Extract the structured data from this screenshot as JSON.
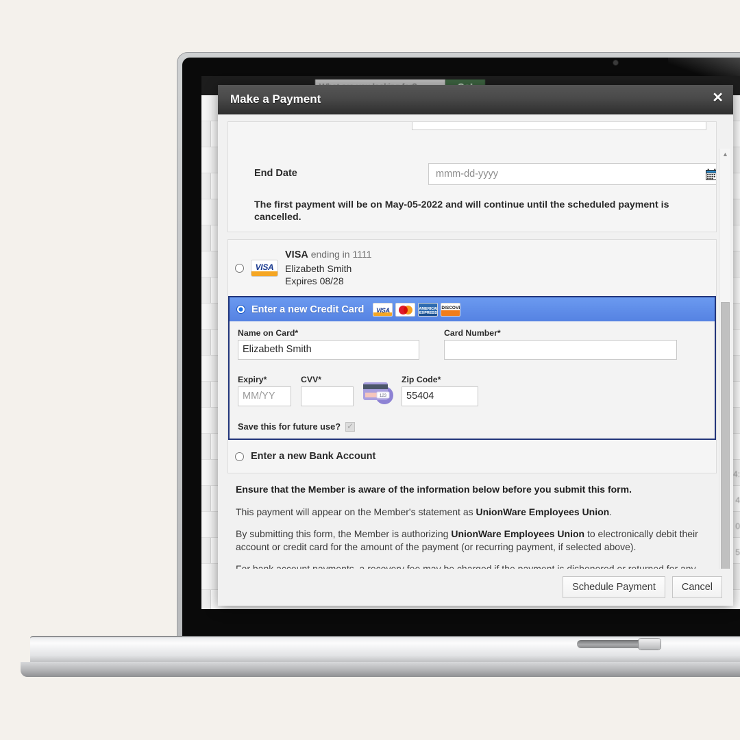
{
  "background_page": {
    "search_placeholder": "What are you looking for?",
    "go_button": "Go!",
    "right_column_fragments": [
      "4:",
      "4",
      "0",
      "5"
    ]
  },
  "modal": {
    "title": "Make a Payment",
    "close_label": "✕",
    "schedule_panel": {
      "end_date_label": "End Date",
      "end_date_placeholder": "mmm-dd-yyyy",
      "calendar_icon": "calendar-icon",
      "note": "The first payment will be on May-05-2022 and will continue until the scheduled payment is cancelled."
    },
    "payment_methods": {
      "saved_card": {
        "brand": "VISA",
        "ending_text": "ending in 1111",
        "holder": "Elizabeth Smith",
        "expires": "Expires 08/28",
        "selected": false
      },
      "new_credit_card": {
        "label": "Enter a new Credit Card",
        "selected": true,
        "accepted_brands": [
          "VISA",
          "MasterCard",
          "AMERICAN EXPRESS",
          "DISCOVER"
        ],
        "fields": {
          "name_label": "Name on Card",
          "name_value": "Elizabeth Smith",
          "card_number_label": "Card Number",
          "card_number_value": "",
          "expiry_label": "Expiry",
          "expiry_placeholder": "MM/YY",
          "cvv_label": "CVV",
          "cvv_value": "",
          "zip_label": "Zip Code",
          "zip_value": "55404",
          "required_marker": "*",
          "cvv_hint_icon": "credit-card-cvv-icon",
          "cvv_hint_digits": "123"
        },
        "save_for_future_label": "Save this for future use?",
        "save_for_future_checked": true
      },
      "new_bank_account": {
        "label": "Enter a new Bank Account",
        "selected": false
      }
    },
    "disclosure": {
      "heading": "Ensure that the Member is aware of the information below before you submit this form.",
      "line2_pre": "This payment will appear on the Member's statement as ",
      "line2_org": "UnionWare Employees Union",
      "line2_post": ".",
      "line3_pre": "By submitting this form, the Member is authorizing ",
      "line3_org": "UnionWare Employees Union",
      "line3_post": " to electronically debit their account or credit card for the amount of the payment (or recurring payment, if selected above).",
      "line4": "For bank account payments, a recovery fee may be charged if the payment is dishonored or returned for any reason."
    },
    "footer": {
      "submit_label": "Schedule Payment",
      "cancel_label": "Cancel"
    },
    "scrollbar": {
      "up_arrow": "▲",
      "down_arrow": "▼"
    }
  },
  "colors": {
    "page_background": "#f4f1ec",
    "modal_header_dark": "#4a4a4a",
    "accent_blue": "#5582e2",
    "accent_blue_border": "#22357a",
    "go_button_green": "#3c6340",
    "visa_blue": "#1a3a8f",
    "visa_gold": "#f5a623"
  }
}
